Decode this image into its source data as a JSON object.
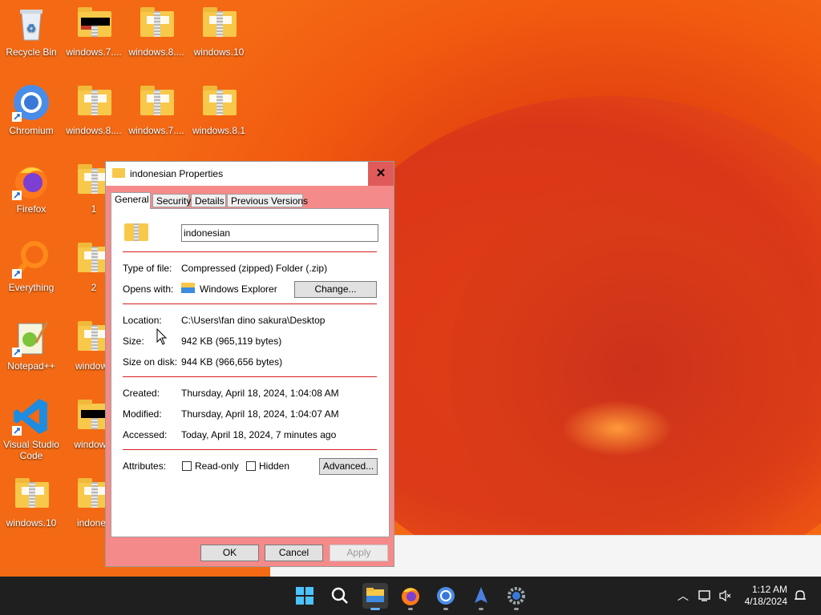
{
  "desktop": {
    "icons": [
      {
        "label": "Recycle Bin"
      },
      {
        "label": "windows.7...."
      },
      {
        "label": "windows.8...."
      },
      {
        "label": "windows.10"
      },
      {
        "label": "Chromium"
      },
      {
        "label": "windows.8...."
      },
      {
        "label": "windows.7...."
      },
      {
        "label": "windows.8.1"
      },
      {
        "label": "Firefox"
      },
      {
        "label": "1"
      },
      {
        "label": "Everything"
      },
      {
        "label": "2"
      },
      {
        "label": "Notepad++"
      },
      {
        "label": "windows"
      },
      {
        "label": "Visual Studio Code"
      },
      {
        "label": "windows."
      },
      {
        "label": "windows.10"
      },
      {
        "label": "indones"
      }
    ]
  },
  "dialog": {
    "title": "indonesian Properties",
    "close_glyph": "✕",
    "tabs": [
      "General",
      "Security",
      "Details",
      "Previous Versions"
    ],
    "name": "indonesian",
    "type_label": "Type of file:",
    "type_value": "Compressed (zipped) Folder (.zip)",
    "opens_label": "Opens with:",
    "opens_value": "Windows Explorer",
    "change_btn": "Change...",
    "location_label": "Location:",
    "location_value": "C:\\Users\\fan dino sakura\\Desktop",
    "size_label": "Size:",
    "size_value": "942 KB (965,119 bytes)",
    "disk_label": "Size on disk:",
    "disk_value": "944 KB (966,656 bytes)",
    "created_label": "Created:",
    "created_value": "Thursday, April 18, 2024, 1:04:08 AM",
    "modified_label": "Modified:",
    "modified_value": "Thursday, April 18, 2024, 1:04:07 AM",
    "accessed_label": "Accessed:",
    "accessed_value": "Today, April 18, 2024, 7 minutes ago",
    "attributes_label": "Attributes:",
    "readonly_label": "Read-only",
    "hidden_label": "Hidden",
    "advanced_btn": "Advanced...",
    "ok_btn": "OK",
    "cancel_btn": "Cancel",
    "apply_btn": "Apply",
    "accent_color": "#f58a8a",
    "separator_color": "#d42020"
  },
  "taskbar": {
    "time": "1:12 AM",
    "date": "4/18/2024",
    "apps": [
      "start-icon",
      "search-icon",
      "file-explorer-icon",
      "firefox-icon",
      "chromium-icon",
      "app-icon",
      "settings-icon"
    ]
  }
}
